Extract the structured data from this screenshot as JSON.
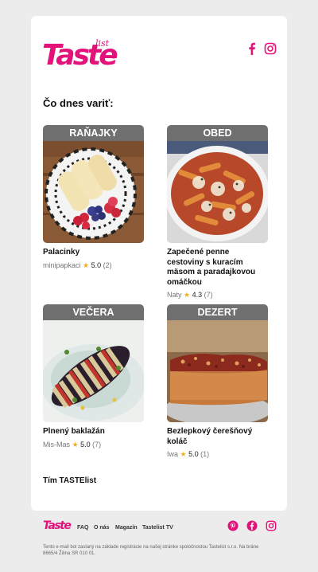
{
  "brand": {
    "name": "Taste",
    "suffix": "list",
    "reg": "®",
    "color": "#e2127a"
  },
  "header": {
    "social": [
      {
        "name": "facebook-icon"
      },
      {
        "name": "instagram-icon"
      }
    ]
  },
  "heading": "Čo dnes variť:",
  "tiles": [
    {
      "category": "RAŇAJKY",
      "title": "Palacinky",
      "author": "minipapkaci",
      "rating": "5.0",
      "count": "(2)"
    },
    {
      "category": "OBED",
      "title": "Zapečené penne cestoviny s kuracím mäsom a paradajkovou omáčkou",
      "author": "Naty",
      "rating": "4.3",
      "count": "(7)"
    },
    {
      "category": "VEČERA",
      "title": "Plnený baklažán",
      "author": "Mis-Mas",
      "rating": "5.0",
      "count": "(7)"
    },
    {
      "category": "DEZERT",
      "title": "Bezlepkový čerešňový koláč",
      "author": "Iwa",
      "rating": "5.0",
      "count": "(1)"
    }
  ],
  "team": "Tím TASTElist",
  "footer": {
    "logo": "Taste",
    "links": [
      "FAQ",
      "O nás",
      "Magazín",
      "Tastelist TV"
    ],
    "legal": "Tento e-mail bol zaslaný na základe registrácie na našej stránke spoločnostou Tastelist s.r.o. Na bráne 8665/4 Žilina SR 010 01."
  }
}
